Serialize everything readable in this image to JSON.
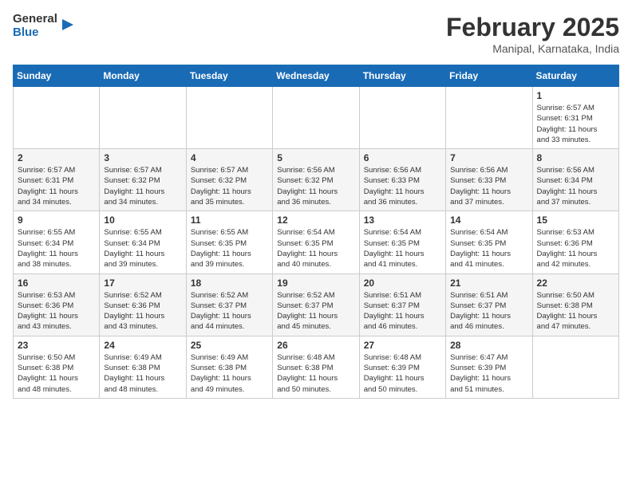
{
  "header": {
    "logo_line1": "General",
    "logo_line2": "Blue",
    "month_title": "February 2025",
    "subtitle": "Manipal, Karnataka, India"
  },
  "days_of_week": [
    "Sunday",
    "Monday",
    "Tuesday",
    "Wednesday",
    "Thursday",
    "Friday",
    "Saturday"
  ],
  "weeks": [
    [
      {
        "day": "",
        "info": ""
      },
      {
        "day": "",
        "info": ""
      },
      {
        "day": "",
        "info": ""
      },
      {
        "day": "",
        "info": ""
      },
      {
        "day": "",
        "info": ""
      },
      {
        "day": "",
        "info": ""
      },
      {
        "day": "1",
        "info": "Sunrise: 6:57 AM\nSunset: 6:31 PM\nDaylight: 11 hours\nand 33 minutes."
      }
    ],
    [
      {
        "day": "2",
        "info": "Sunrise: 6:57 AM\nSunset: 6:31 PM\nDaylight: 11 hours\nand 34 minutes."
      },
      {
        "day": "3",
        "info": "Sunrise: 6:57 AM\nSunset: 6:32 PM\nDaylight: 11 hours\nand 34 minutes."
      },
      {
        "day": "4",
        "info": "Sunrise: 6:57 AM\nSunset: 6:32 PM\nDaylight: 11 hours\nand 35 minutes."
      },
      {
        "day": "5",
        "info": "Sunrise: 6:56 AM\nSunset: 6:32 PM\nDaylight: 11 hours\nand 36 minutes."
      },
      {
        "day": "6",
        "info": "Sunrise: 6:56 AM\nSunset: 6:33 PM\nDaylight: 11 hours\nand 36 minutes."
      },
      {
        "day": "7",
        "info": "Sunrise: 6:56 AM\nSunset: 6:33 PM\nDaylight: 11 hours\nand 37 minutes."
      },
      {
        "day": "8",
        "info": "Sunrise: 6:56 AM\nSunset: 6:34 PM\nDaylight: 11 hours\nand 37 minutes."
      }
    ],
    [
      {
        "day": "9",
        "info": "Sunrise: 6:55 AM\nSunset: 6:34 PM\nDaylight: 11 hours\nand 38 minutes."
      },
      {
        "day": "10",
        "info": "Sunrise: 6:55 AM\nSunset: 6:34 PM\nDaylight: 11 hours\nand 39 minutes."
      },
      {
        "day": "11",
        "info": "Sunrise: 6:55 AM\nSunset: 6:35 PM\nDaylight: 11 hours\nand 39 minutes."
      },
      {
        "day": "12",
        "info": "Sunrise: 6:54 AM\nSunset: 6:35 PM\nDaylight: 11 hours\nand 40 minutes."
      },
      {
        "day": "13",
        "info": "Sunrise: 6:54 AM\nSunset: 6:35 PM\nDaylight: 11 hours\nand 41 minutes."
      },
      {
        "day": "14",
        "info": "Sunrise: 6:54 AM\nSunset: 6:35 PM\nDaylight: 11 hours\nand 41 minutes."
      },
      {
        "day": "15",
        "info": "Sunrise: 6:53 AM\nSunset: 6:36 PM\nDaylight: 11 hours\nand 42 minutes."
      }
    ],
    [
      {
        "day": "16",
        "info": "Sunrise: 6:53 AM\nSunset: 6:36 PM\nDaylight: 11 hours\nand 43 minutes."
      },
      {
        "day": "17",
        "info": "Sunrise: 6:52 AM\nSunset: 6:36 PM\nDaylight: 11 hours\nand 43 minutes."
      },
      {
        "day": "18",
        "info": "Sunrise: 6:52 AM\nSunset: 6:37 PM\nDaylight: 11 hours\nand 44 minutes."
      },
      {
        "day": "19",
        "info": "Sunrise: 6:52 AM\nSunset: 6:37 PM\nDaylight: 11 hours\nand 45 minutes."
      },
      {
        "day": "20",
        "info": "Sunrise: 6:51 AM\nSunset: 6:37 PM\nDaylight: 11 hours\nand 46 minutes."
      },
      {
        "day": "21",
        "info": "Sunrise: 6:51 AM\nSunset: 6:37 PM\nDaylight: 11 hours\nand 46 minutes."
      },
      {
        "day": "22",
        "info": "Sunrise: 6:50 AM\nSunset: 6:38 PM\nDaylight: 11 hours\nand 47 minutes."
      }
    ],
    [
      {
        "day": "23",
        "info": "Sunrise: 6:50 AM\nSunset: 6:38 PM\nDaylight: 11 hours\nand 48 minutes."
      },
      {
        "day": "24",
        "info": "Sunrise: 6:49 AM\nSunset: 6:38 PM\nDaylight: 11 hours\nand 48 minutes."
      },
      {
        "day": "25",
        "info": "Sunrise: 6:49 AM\nSunset: 6:38 PM\nDaylight: 11 hours\nand 49 minutes."
      },
      {
        "day": "26",
        "info": "Sunrise: 6:48 AM\nSunset: 6:38 PM\nDaylight: 11 hours\nand 50 minutes."
      },
      {
        "day": "27",
        "info": "Sunrise: 6:48 AM\nSunset: 6:39 PM\nDaylight: 11 hours\nand 50 minutes."
      },
      {
        "day": "28",
        "info": "Sunrise: 6:47 AM\nSunset: 6:39 PM\nDaylight: 11 hours\nand 51 minutes."
      },
      {
        "day": "",
        "info": ""
      }
    ]
  ]
}
